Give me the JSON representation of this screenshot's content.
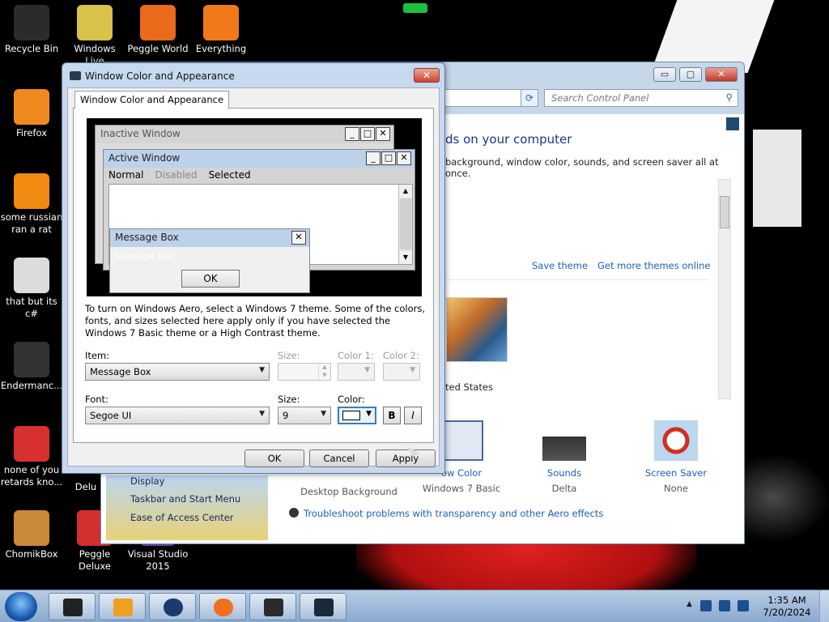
{
  "desktop": {
    "icons": [
      {
        "label": "Recycle Bin",
        "icon": "recycle-bin-icon",
        "color": "#2b2b2b"
      },
      {
        "label": "Windows Live",
        "icon": "folder-icon",
        "color": "#d8c24a"
      },
      {
        "label": "Peggle World",
        "icon": "peggle-icon",
        "color": "#e86a1a"
      },
      {
        "label": "Everything",
        "icon": "magnifier-icon",
        "color": "#f07a1a"
      },
      {
        "label": "Firefox",
        "icon": "firefox-icon",
        "color": "#f08a20"
      },
      {
        "label": "some russian ran a rat",
        "icon": "app-icon",
        "color": "#f08a10"
      },
      {
        "label": "that but its c#",
        "icon": "shortcut-icon",
        "color": "#dcdcdc"
      },
      {
        "label": "Endermanc...",
        "icon": "window-icon",
        "color": "#333333"
      },
      {
        "label": "none of you retards kno...",
        "icon": "app-icon",
        "color": "#d83030"
      },
      {
        "label": "ChomikBox",
        "icon": "hamster-icon",
        "color": "#c98a3a"
      },
      {
        "label": "Peggle Deluxe",
        "icon": "peggle-icon",
        "color": "#d03030"
      },
      {
        "label": "Visual Studio 2015",
        "icon": "vs-icon",
        "color": "#6a3da0"
      }
    ],
    "partial_label": "Delu"
  },
  "control_panel": {
    "search_placeholder": "Search Control Panel",
    "heading": "ds on your computer",
    "subtext": "background, window color, sounds, and screen saver all at once.",
    "save_theme": "Save theme",
    "get_more": "Get more themes online",
    "theme_name": "ted States",
    "items": [
      {
        "title": "ow Color",
        "sub": "Windows 7 Basic"
      },
      {
        "title": "Sounds",
        "sub": "Delta"
      },
      {
        "title": "Screen Saver",
        "sub": "None"
      }
    ],
    "desktop_bg": "Desktop Background",
    "troubleshoot": "Troubleshoot problems with transparency and other Aero effects",
    "see_also": [
      "Display",
      "Taskbar and Start Menu",
      "Ease of Access Center"
    ]
  },
  "dialog": {
    "title": "Window Color and Appearance",
    "tab": "Window Color and Appearance",
    "preview": {
      "inactive_title": "Inactive Window",
      "active_title": "Active Window",
      "menu": [
        "Normal",
        "Disabled",
        "Selected"
      ],
      "msgbox_title": "Message Box",
      "msgbox_text": "Message Text",
      "ok": "OK"
    },
    "hint": "To turn on Windows Aero, select a Windows 7 theme.  Some of the colors, fonts, and sizes selected here apply only if you have selected the Windows 7 Basic theme or a High Contrast theme.",
    "item_label": "Item:",
    "item_value": "Message Box",
    "size_label": "Size:",
    "color1_label": "Color 1:",
    "color2_label": "Color 2:",
    "font_label": "Font:",
    "font_value": "Segoe UI",
    "font_size_label": "Size:",
    "font_size_value": "9",
    "font_color_label": "Color:",
    "bold": "B",
    "italic": "I",
    "ok": "OK",
    "cancel": "Cancel",
    "apply": "Apply"
  },
  "taskbar": {
    "time": "1:35 AM",
    "date": "7/20/2024"
  }
}
